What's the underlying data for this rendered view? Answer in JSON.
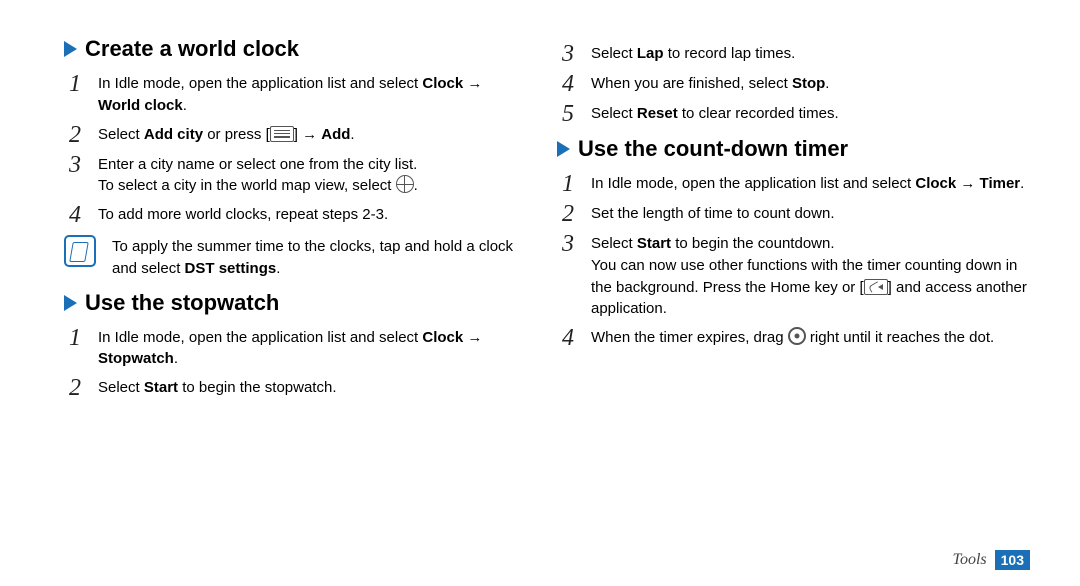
{
  "left": {
    "section_a": {
      "heading": "Create a world clock",
      "steps": [
        {
          "pre": "In Idle mode, open the application list and select ",
          "b": "Clock → World clock",
          "post": "."
        },
        {
          "pre": "Select ",
          "b": "Add city",
          "mid": " or press [",
          "icon": "menu",
          "mid2": "] → ",
          "b2": "Add",
          "post2": "."
        },
        {
          "line1": "Enter a city name or select one from the city list.",
          "line2a": "To select a city in the world map view, select ",
          "icon": "globe",
          "line2b": "."
        },
        {
          "pre": "To add more world clocks, repeat steps 2-3."
        }
      ],
      "note": {
        "line1": "To apply the summer time to the clocks, tap and hold a clock and select ",
        "b": "DST settings",
        "post": "."
      }
    },
    "section_b": {
      "heading": "Use the stopwatch",
      "steps": [
        {
          "pre": "In Idle mode, open the application list and select ",
          "b": "Clock → Stopwatch",
          "post": "."
        },
        {
          "pre": "Select ",
          "b": "Start",
          "post": " to begin the stopwatch."
        }
      ]
    }
  },
  "right": {
    "stopwatch_cont": [
      {
        "pre": "Select ",
        "b": "Lap",
        "post": " to record lap times."
      },
      {
        "pre": "When you are finished, select ",
        "b": "Stop",
        "post": "."
      },
      {
        "pre": "Select ",
        "b": "Reset",
        "post": " to clear recorded times."
      }
    ],
    "section_c": {
      "heading": "Use the count-down timer",
      "steps": [
        {
          "pre": "In Idle mode, open the application list and select ",
          "b": "Clock → Timer",
          "post": "."
        },
        {
          "pre": "Set the length of time to count down."
        },
        {
          "pre": "Select ",
          "b": "Start",
          "post": " to begin the countdown.",
          "extra_pre": "You can now use other functions with the timer counting down in the background. Press the Home key or [",
          "icon": "back",
          "extra_post": "] and access another application."
        },
        {
          "pre": "When the timer expires, drag ",
          "icon": "ring",
          "post": " right until it reaches the dot."
        }
      ]
    }
  },
  "footer": {
    "section": "Tools",
    "page": "103"
  }
}
